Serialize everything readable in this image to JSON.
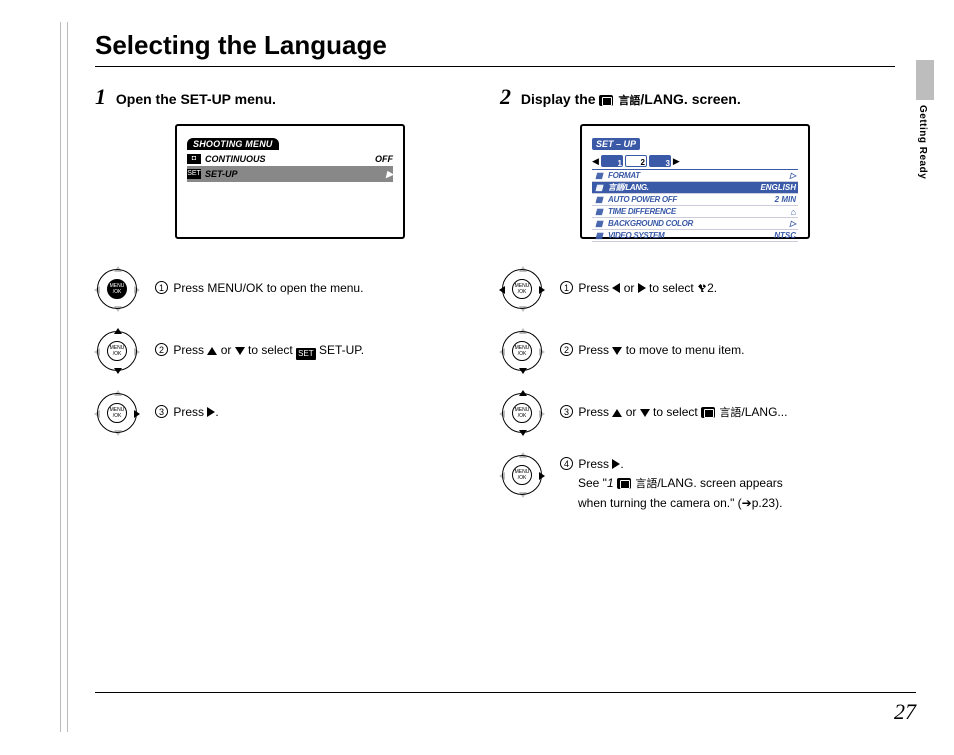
{
  "title": "Selecting the Language",
  "side_label": "Getting Ready",
  "page_number": "27",
  "step1": {
    "heading": "Open the SET-UP menu.",
    "lcd": {
      "tab": "SHOOTING MENU",
      "rows": [
        {
          "icon": "◘",
          "label": "CONTINUOUS",
          "value": "OFF"
        },
        {
          "icon": "SET",
          "label": "SET-UP",
          "value": "▶"
        }
      ]
    },
    "instr": [
      {
        "n": "1",
        "text_a": "Press MENU/OK to open the menu."
      },
      {
        "n": "2",
        "text_a": "Press ",
        "text_b": " or ",
        "text_c": " to select ",
        "badge": "SET",
        "text_d": " SET-UP."
      },
      {
        "n": "3",
        "text_a": "Press ",
        "text_b": "."
      }
    ]
  },
  "step2": {
    "heading_a": "Display the ",
    "heading_kanji": "言語",
    "heading_lang": "/LANG.",
    "heading_b": " screen.",
    "lcd": {
      "title": "SET – UP",
      "tabs": [
        "1",
        "2",
        "3"
      ],
      "rows": [
        {
          "label": "FORMAT",
          "value": "▷"
        },
        {
          "label": "言語/LANG.",
          "value": "ENGLISH",
          "hi": true
        },
        {
          "label": "AUTO POWER OFF",
          "value": "2 MIN"
        },
        {
          "label": "TIME DIFFERENCE",
          "value": "⌂"
        },
        {
          "label": "BACKGROUND COLOR",
          "value": "▷"
        },
        {
          "label": "VIDEO SYSTEM",
          "value": "NTSC"
        }
      ]
    },
    "instr": [
      {
        "n": "1",
        "text_a": "Press ",
        "text_b": " or ",
        "text_c": " to select ",
        "text_d": "2",
        "text_e": "."
      },
      {
        "n": "2",
        "text_a": "Press ",
        "text_b": " to move to menu item."
      },
      {
        "n": "3",
        "text_a": "Press ",
        "text_b": " or ",
        "text_c": " to select ",
        "kanji": "言語",
        "lang": "/LANG.",
        "text_d": ".."
      },
      {
        "n": "4",
        "line1_a": "Press ",
        "line1_b": ".",
        "line2_a": "See \"",
        "line2_ref": "1",
        "line2_kanji": "言語",
        "line2_lang": "/LANG.",
        "line2_b": " screen appears",
        "line3": "when turning the camera on.\" (➔p.23)."
      }
    ]
  }
}
